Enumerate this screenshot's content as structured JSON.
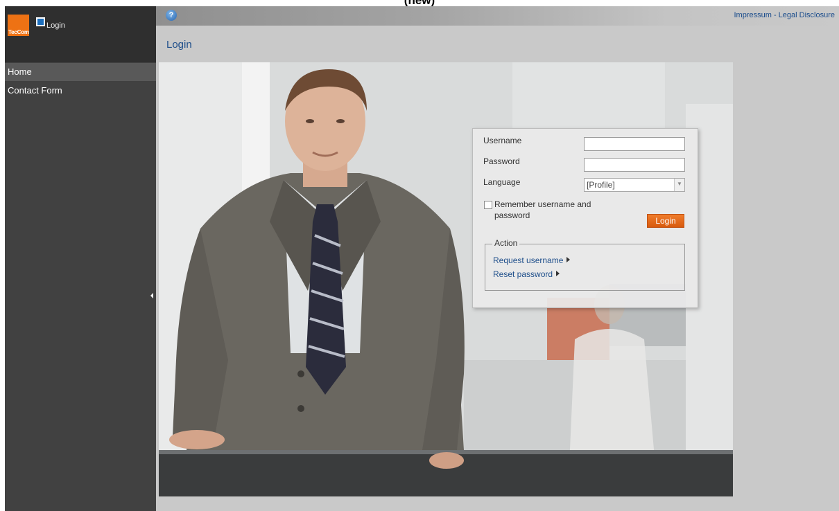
{
  "caption": {
    "text": "(new)"
  },
  "sidebar": {
    "logo_text": "TecCom",
    "app_title": "Login",
    "items": [
      {
        "label": "Home"
      },
      {
        "label": "Contact Form"
      }
    ]
  },
  "topbar": {
    "help_label": "?",
    "impressum": "Impressum - Legal Disclosure"
  },
  "page": {
    "title": "Login"
  },
  "login": {
    "username_label": "Username",
    "username_value": "",
    "password_label": "Password",
    "password_value": "",
    "language_label": "Language",
    "language_selected": "[Profile]",
    "remember_label": "Remember username and password",
    "remember_checked": false,
    "login_button": "Login",
    "action_title": "Action",
    "actions": [
      {
        "label": "Request username"
      },
      {
        "label": "Reset password"
      }
    ]
  },
  "colors": {
    "accent": "#ee7214",
    "link": "#1f4f8b",
    "sidebar_bg": "#414141",
    "main_bg": "#c9c9c9"
  }
}
